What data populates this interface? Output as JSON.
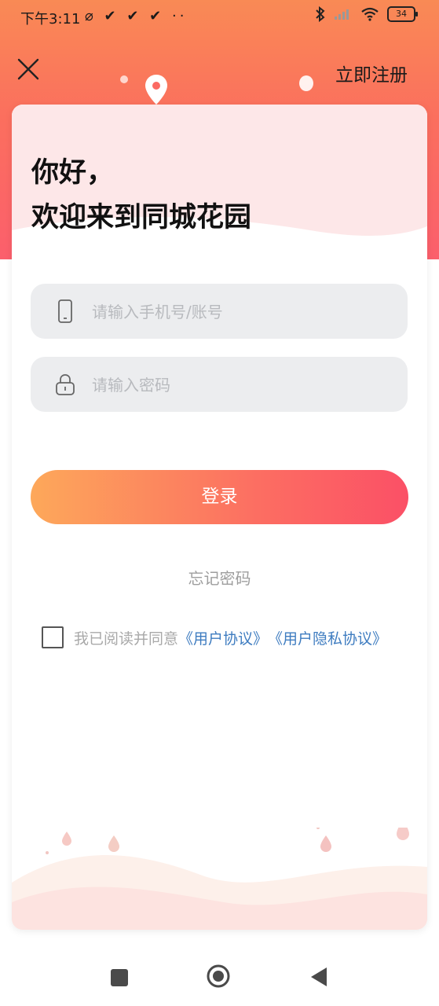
{
  "status_bar": {
    "time": "下午3:11",
    "left_icons": "⌀ ✔ ✔ ✔ ··",
    "battery": "34"
  },
  "header": {
    "register_label": "立即注册"
  },
  "greeting": {
    "line1": "你好，",
    "line2": "欢迎来到同城花园"
  },
  "form": {
    "phone_placeholder": "请输入手机号/账号",
    "password_placeholder": "请输入密码",
    "login_label": "登录",
    "forgot_label": "忘记密码"
  },
  "agreement": {
    "prefix": "我已阅读并同意",
    "user_agreement": "《用户协议》",
    "privacy_agreement": "《用户隐私协议》"
  },
  "colors": {
    "accent_orange": "#fda85a",
    "accent_red": "#fb5066",
    "link_blue": "#3e7cc0"
  }
}
